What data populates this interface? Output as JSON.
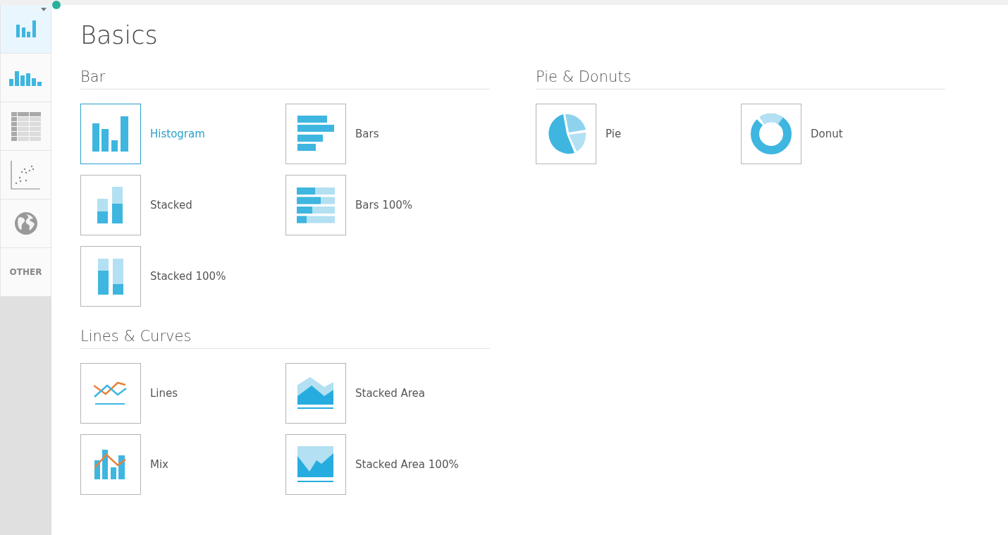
{
  "sidebar": {
    "tabs": [
      {
        "kind": "bar-chart",
        "selected": true
      },
      {
        "kind": "histogram",
        "selected": false
      },
      {
        "kind": "table",
        "selected": false
      },
      {
        "kind": "scatter",
        "selected": false
      },
      {
        "kind": "globe",
        "selected": false
      },
      {
        "kind": "text",
        "label": "OTHER",
        "selected": false
      }
    ]
  },
  "title": "Basics",
  "columns": [
    [
      {
        "heading": "Bar",
        "items": [
          {
            "kind": "histogram",
            "label": "Histogram",
            "selected": true
          },
          {
            "kind": "bars",
            "label": "Bars",
            "selected": false
          },
          {
            "kind": "stacked",
            "label": "Stacked",
            "selected": false
          },
          {
            "kind": "bars100",
            "label": "Bars 100%",
            "selected": false
          },
          {
            "kind": "stacked100",
            "label": "Stacked 100%",
            "selected": false
          }
        ]
      },
      {
        "heading": "Lines & Curves",
        "items": [
          {
            "kind": "lines",
            "label": "Lines",
            "selected": false
          },
          {
            "kind": "area",
            "label": "Stacked Area",
            "selected": false
          },
          {
            "kind": "mix",
            "label": "Mix",
            "selected": false
          },
          {
            "kind": "area100",
            "label": "Stacked Area 100%",
            "selected": false
          }
        ]
      }
    ],
    [
      {
        "heading": "Pie & Donuts",
        "items": [
          {
            "kind": "pie",
            "label": "Pie",
            "selected": false
          },
          {
            "kind": "donut",
            "label": "Donut",
            "selected": false
          }
        ]
      }
    ]
  ]
}
